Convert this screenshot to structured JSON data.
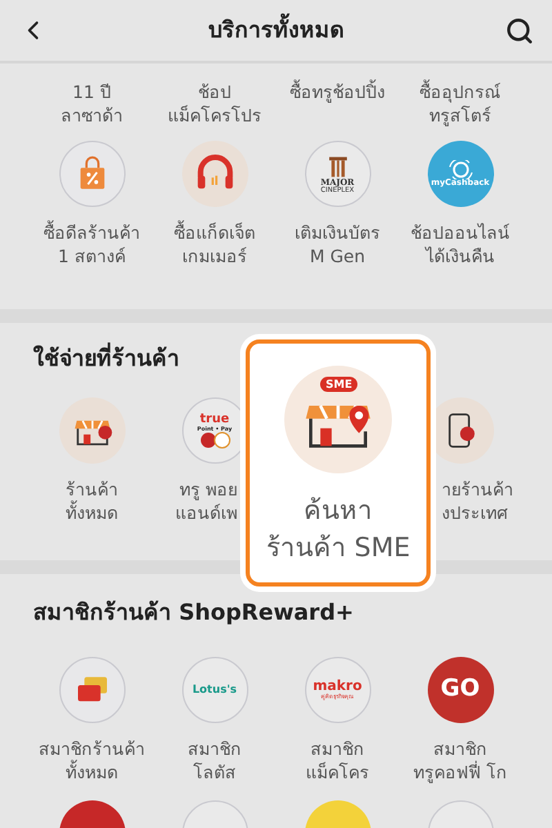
{
  "header": {
    "title": "บริการทั้งหมด"
  },
  "top_section": {
    "labels": [
      [
        "11 ปี",
        "ลาซาด้า"
      ],
      [
        "ช้อป",
        "แม็คโครโปร"
      ],
      [
        "ซื้อทรูช้อปปิ้ง"
      ],
      [
        "ซื้ออุปกรณ์",
        "ทรูสโตร์"
      ]
    ],
    "items": [
      {
        "kind": "sale-bag",
        "lines": [
          "ซื้อดีลร้านค้า",
          "1 สตางค์"
        ]
      },
      {
        "kind": "headphones",
        "lines": [
          "ซื้อแก็ดเจ็ต",
          "เกมเมอร์"
        ]
      },
      {
        "kind": "cinema",
        "logo_text": [
          "MAJOR",
          "CINEPLEX"
        ],
        "lines": [
          "เติมเงินบัตร",
          "M Gen"
        ]
      },
      {
        "kind": "cashback",
        "logo_text": [
          "myCashback"
        ],
        "lines": [
          "ช้อปออนไลน์",
          "ได้เงินคืน"
        ]
      }
    ]
  },
  "spend_section": {
    "title": "ใช้จ่ายที่ร้านค้า",
    "items": [
      {
        "kind": "store-chat",
        "lines": [
          "ร้านค้า",
          "ทั้งหมด"
        ]
      },
      {
        "kind": "points-pay",
        "logo_text": [
          "true",
          "Point • Pay"
        ],
        "lines": [
          "ทรู พอย",
          "แอนด์เพ"
        ]
      },
      {
        "kind": "phone-globe",
        "lines": [
          "ายร้านค้า",
          "งประเทศ"
        ]
      }
    ]
  },
  "spotlight": {
    "badge": "SME",
    "lines": [
      "ค้นหา",
      "ร้านค้า SME"
    ]
  },
  "member_section": {
    "title": "สมาชิกร้านค้า ShopReward+",
    "items": [
      {
        "kind": "cards",
        "lines": [
          "สมาชิกร้านค้า",
          "ทั้งหมด"
        ]
      },
      {
        "kind": "lotus",
        "logo_text": [
          "Lotus's"
        ],
        "lines": [
          "สมาชิก",
          "โลตัส"
        ]
      },
      {
        "kind": "makro",
        "logo_text": [
          "makro",
          "คู่คิดธุรกิจคุณ"
        ],
        "lines": [
          "สมาชิก",
          "แม็คโคร"
        ]
      },
      {
        "kind": "go",
        "logo_text": [
          "GO"
        ],
        "lines": [
          "สมาชิก",
          "ทรูคอฟฟี่ โก"
        ]
      }
    ],
    "next_row": [
      {
        "kind": "red"
      },
      {
        "kind": "plain"
      },
      {
        "kind": "yellow"
      },
      {
        "kind": "plain"
      }
    ]
  }
}
